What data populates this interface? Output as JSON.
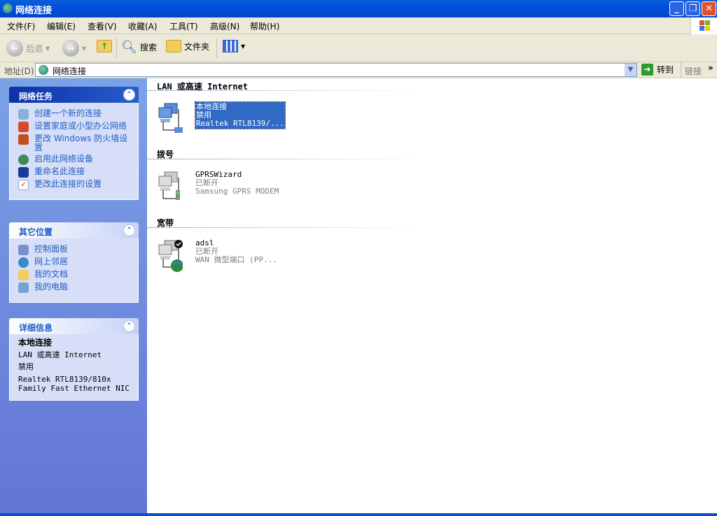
{
  "window": {
    "title": "网络连接"
  },
  "menu": [
    "文件(F)",
    "编辑(E)",
    "查看(V)",
    "收藏(A)",
    "工具(T)",
    "高级(N)",
    "帮助(H)"
  ],
  "toolbar": {
    "back": "后退",
    "search": "搜索",
    "folders": "文件夹"
  },
  "address": {
    "label": "地址(D)",
    "value": "网络连接",
    "go": "转到",
    "links": "链接",
    "more": "»"
  },
  "sidebar": {
    "network_tasks": {
      "title": "网络任务",
      "items": [
        "创建一个新的连接",
        "设置家庭或小型办公网络",
        "更改 Windows 防火墙设置",
        "启用此网络设备",
        "重命名此连接",
        "更改此连接的设置"
      ]
    },
    "other_places": {
      "title": "其它位置",
      "items": [
        "控制面板",
        "网上邻居",
        "我的文档",
        "我的电脑"
      ]
    },
    "details": {
      "title": "详细信息",
      "name": "本地连接",
      "type": "LAN 或高速 Internet",
      "status": "禁用",
      "device": "Realtek RTL8139/810x Family Fast Ethernet NIC"
    }
  },
  "groups": [
    {
      "title": "LAN 或高速 Internet",
      "items": [
        {
          "name": "本地连接",
          "status": "禁用",
          "device": "Realtek RTL8139/...",
          "selected": true
        }
      ]
    },
    {
      "title": "拨号",
      "items": [
        {
          "name": "GPRSWizard",
          "status": "已断开",
          "device": "Samsung GPRS MODEM"
        }
      ]
    },
    {
      "title": "宽带",
      "items": [
        {
          "name": "adsl",
          "status": "已断开",
          "device": "WAN 微型端口 (PP..."
        }
      ]
    }
  ]
}
